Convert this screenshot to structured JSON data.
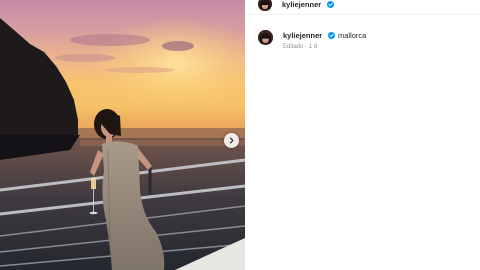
{
  "post": {
    "image": {
      "description_icon": "sunset-yacht-photo",
      "next_icon": "chevron-right-icon"
    },
    "header": {
      "username": "kyliejenner",
      "verified_icon": "verified-badge-icon"
    },
    "caption": {
      "username": "kyliejenner",
      "text": "mallorca",
      "edited_label": "Editado",
      "separator": "·",
      "time": "1 d"
    }
  },
  "colors": {
    "verified": "#0095f6",
    "text": "#262626",
    "muted": "#8e8e8e"
  }
}
